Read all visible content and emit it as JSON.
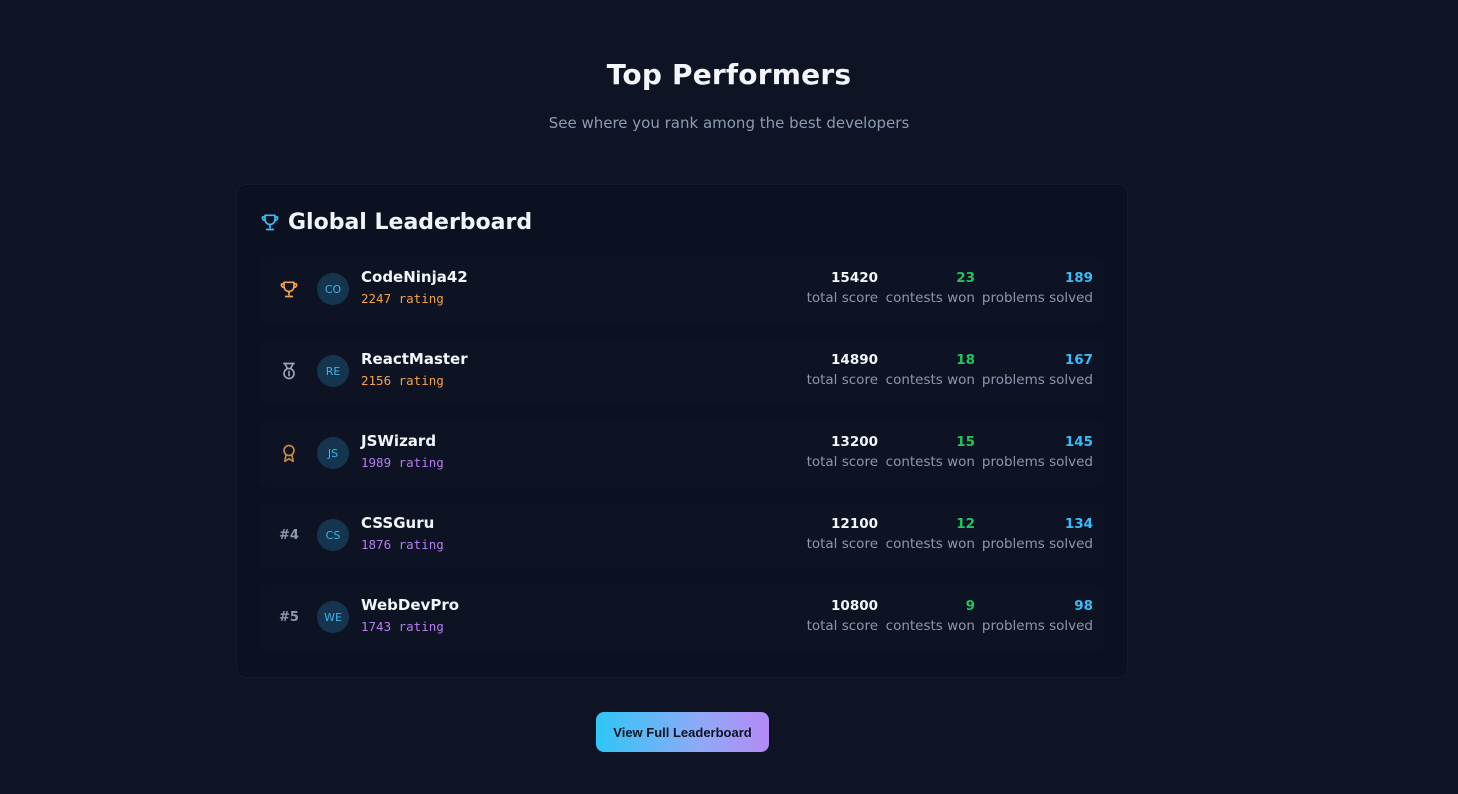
{
  "header": {
    "title": "Top Performers",
    "subtitle": "See where you rank among the best developers"
  },
  "leaderboard": {
    "title": "Global Leaderboard",
    "title_icon": "trophy-icon",
    "stat_labels": {
      "score": "total score",
      "won": "contests won",
      "solved": "problems solved"
    },
    "rows": [
      {
        "rank_icon": "trophy-icon",
        "rank_text": "",
        "initials": "CO",
        "name": "CodeNinja42",
        "rating": "2247 rating",
        "rating_color": "#f5a14a",
        "score": "15420",
        "won": "23",
        "solved": "189"
      },
      {
        "rank_icon": "medal-icon",
        "rank_text": "",
        "initials": "RE",
        "name": "ReactMaster",
        "rating": "2156 rating",
        "rating_color": "#f5a14a",
        "score": "14890",
        "won": "18",
        "solved": "167"
      },
      {
        "rank_icon": "award-icon",
        "rank_text": "",
        "initials": "JS",
        "name": "JSWizard",
        "rating": "1989 rating",
        "rating_color": "#b67cf0",
        "score": "13200",
        "won": "15",
        "solved": "145"
      },
      {
        "rank_icon": "",
        "rank_text": "#4",
        "initials": "CS",
        "name": "CSSGuru",
        "rating": "1876 rating",
        "rating_color": "#b67cf0",
        "score": "12100",
        "won": "12",
        "solved": "134"
      },
      {
        "rank_icon": "",
        "rank_text": "#5",
        "initials": "WE",
        "name": "WebDevPro",
        "rating": "1743 rating",
        "rating_color": "#b67cf0",
        "score": "10800",
        "won": "9",
        "solved": "98"
      }
    ]
  },
  "footer": {
    "button_label": "View Full Leaderboard"
  },
  "colors": {
    "background": "#0e1424",
    "accent_cyan": "#38bdf8",
    "accent_green": "#22c55e",
    "gold": "#f5a14a",
    "silver": "#9aa6b8",
    "bronze": "#c98a3c"
  }
}
